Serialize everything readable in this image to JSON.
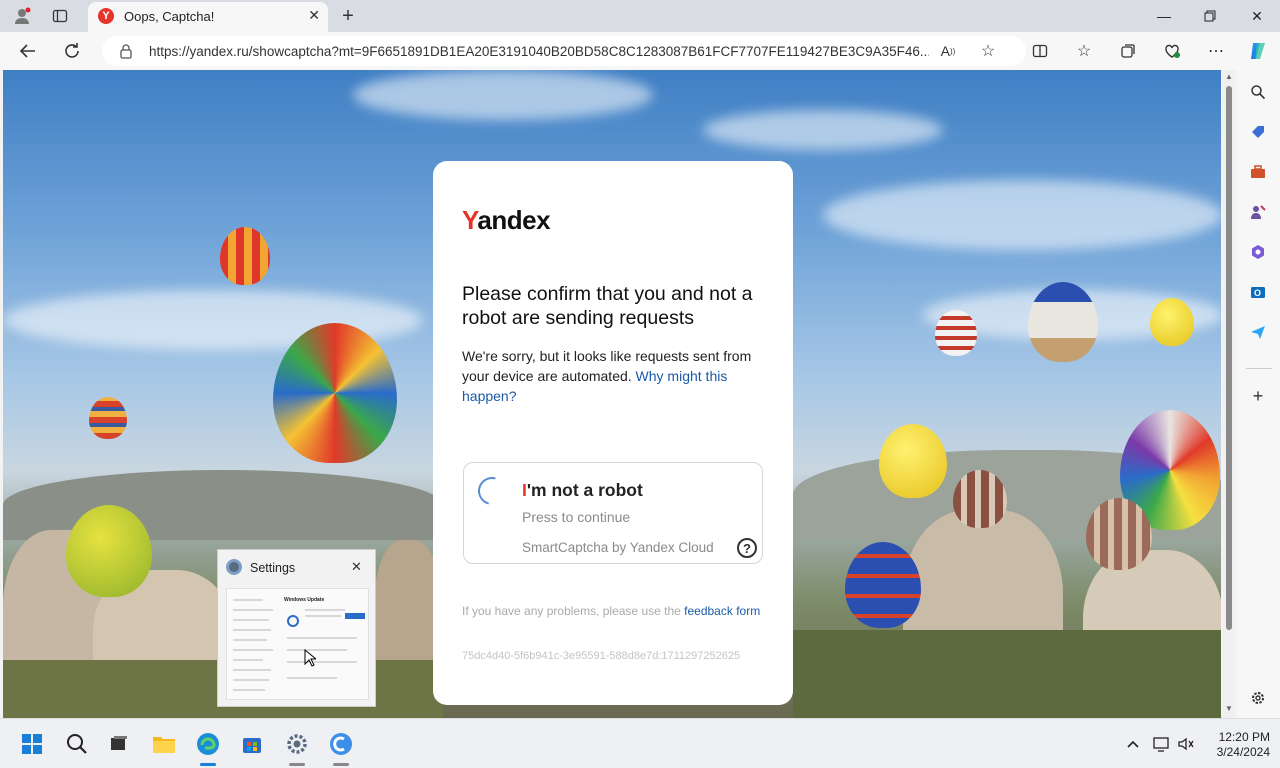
{
  "browser": {
    "tab_title": "Oops, Captcha!",
    "tab_favicon_letter": "Y",
    "url": "https://yandex.ru/showcaptcha?mt=9F6651891DB1EA20E3191040B20BD58C8C1283087B61FCF7707FE119427BE3C9A35F46..."
  },
  "captcha": {
    "logo_first": "Y",
    "logo_rest": "andex",
    "title": "Please confirm that you and not a robot are sending requests",
    "text": "We're sorry, but it looks like requests sent from your device are automated.",
    "why_link": "Why might this happen?",
    "robot_first": "I",
    "robot_rest": "'m not a robot",
    "press_continue": "Press to continue",
    "brand": "SmartCaptcha by Yandex Cloud",
    "help_symbol": "?",
    "problems_text": "If you have any problems, please use the",
    "feedback_link": "feedback form",
    "hash": "75dc4d40-5f6b941c-3e95591-588d8e7d:1711297252625"
  },
  "settings_thumbnail": {
    "title": "Settings",
    "heading": "Windows Update"
  },
  "taskbar": {
    "time": "12:20 PM",
    "date": "3/24/2024"
  },
  "colors": {
    "yandex_red": "#e5342a",
    "link_blue": "#1a5aa8"
  }
}
